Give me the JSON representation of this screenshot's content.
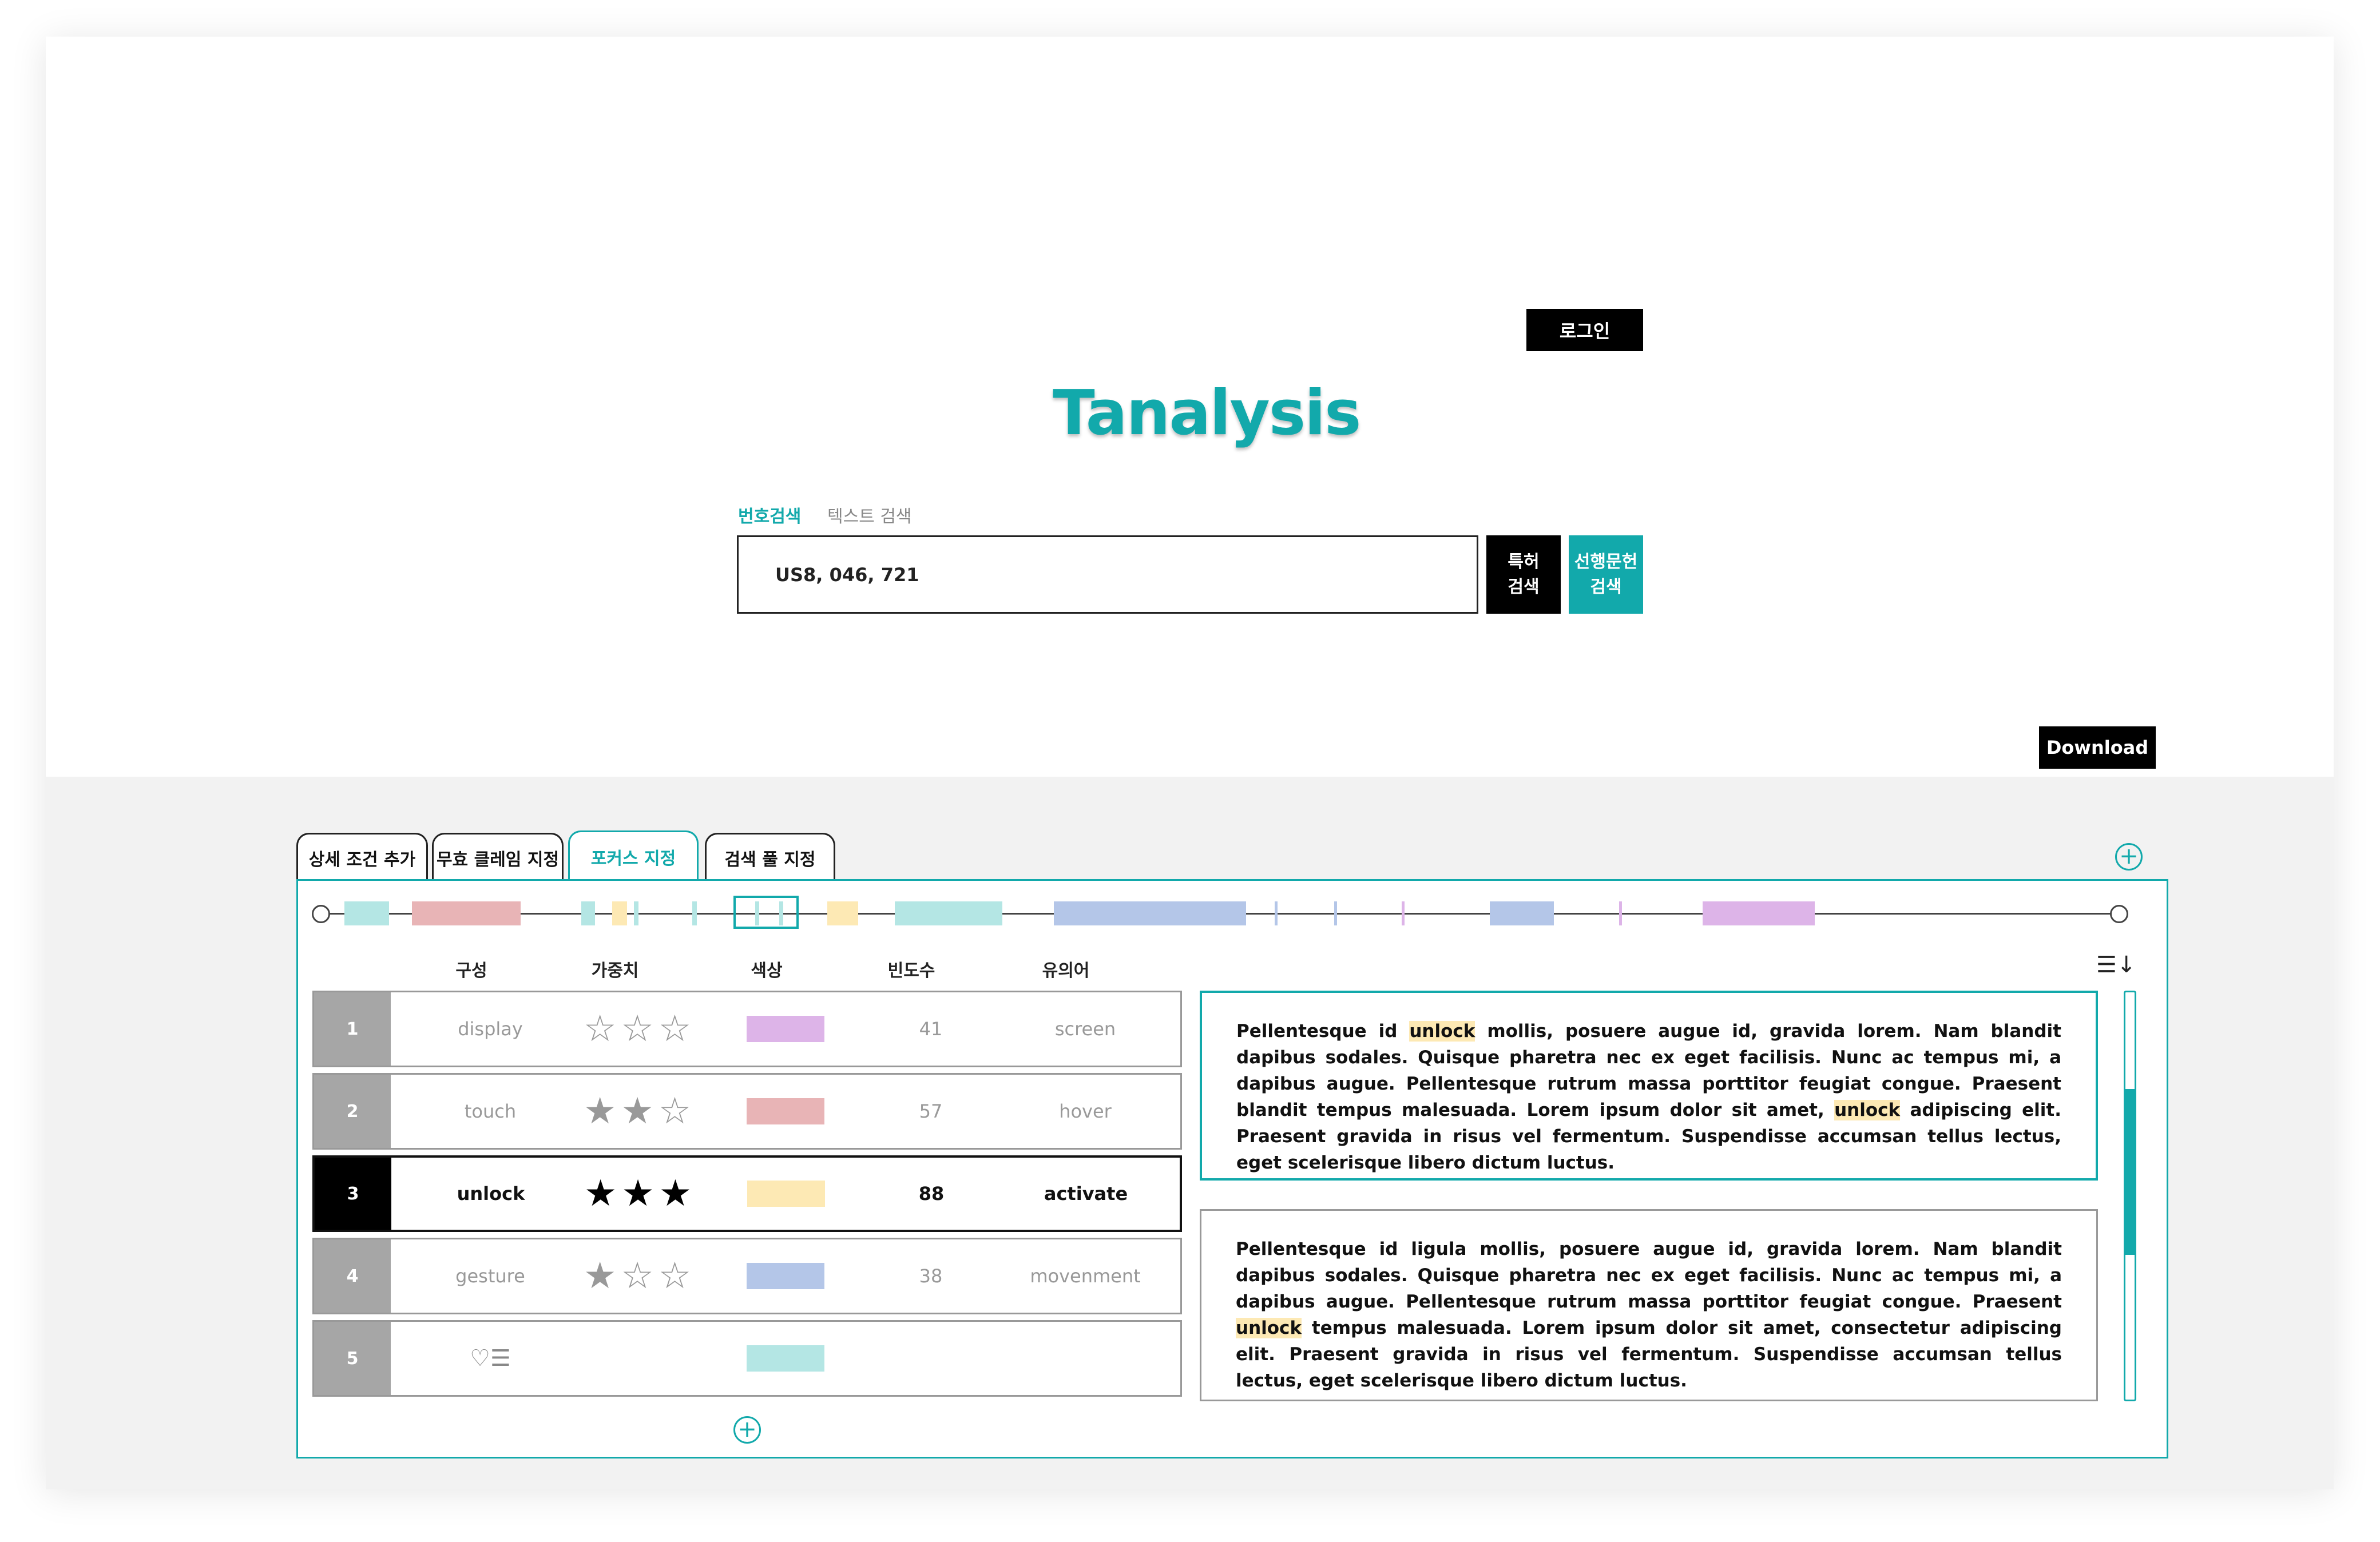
{
  "header": {
    "login_label": "로그인",
    "logo": "Tanalysis",
    "search_modes": [
      "번호검색",
      "텍스트 검색"
    ],
    "search_value": "US8, 046, 721",
    "patent_search_label": "특허\n검색",
    "prior_art_search_label": "선행문헌\n검색",
    "download_label": "Download"
  },
  "tabs": [
    {
      "label": "상세 조건 추가"
    },
    {
      "label": "무효 클레임 지정"
    },
    {
      "label": "포커스 지정"
    },
    {
      "label": "검색 풀 지정"
    }
  ],
  "table": {
    "headers": [
      "구성",
      "가중치",
      "색상",
      "빈도수",
      "유의어"
    ],
    "rows": [
      {
        "num": "1",
        "term": "display",
        "stars": 0,
        "color": "#ddb4e8",
        "freq": "41",
        "synonym": "screen"
      },
      {
        "num": "2",
        "term": "touch",
        "stars": 2,
        "color": "#e8b4b6",
        "freq": "57",
        "synonym": "hover"
      },
      {
        "num": "3",
        "term": "unlock",
        "stars": 3,
        "color": "#fde9b4",
        "freq": "88",
        "synonym": "activate"
      },
      {
        "num": "4",
        "term": "gesture",
        "stars": 1,
        "color": "#b4c6e8",
        "freq": "38",
        "synonym": "movenment"
      },
      {
        "num": "5",
        "term": "",
        "stars": null,
        "color": "#b4e6e4",
        "freq": "",
        "synonym": ""
      }
    ]
  },
  "texts": [
    {
      "parts": [
        {
          "t": "Pellentesque id "
        },
        {
          "t": "unlock",
          "hl": true
        },
        {
          "t": " mollis, posuere augue id, gravida lorem. Nam blandit dapibus sodales. Quisque pharetra nec ex eget facilisis. Nunc ac tempus mi, a dapibus augue. Pellentesque rutrum massa porttitor feugiat congue. Praesent blandit tempus malesuada. Lorem ipsum dolor sit amet, "
        },
        {
          "t": "unlock",
          "hl": true
        },
        {
          "t": " adipiscing elit. Praesent gravida in risus vel fermentum. Suspendisse accumsan tellus lectus, eget scelerisque libero dictum luctus."
        }
      ]
    },
    {
      "parts": [
        {
          "t": "Pellentesque id ligula mollis, posuere augue id, gravida lorem. Nam blandit dapibus sodales. Quisque pharetra nec ex eget facilisis. Nunc ac tempus mi, a dapibus augue. Pellentesque rutrum massa porttitor feugiat congue. Praesent "
        },
        {
          "t": "unlock",
          "hl": true
        },
        {
          "t": " tempus malesuada. Lorem ipsum dolor sit amet, consectetur adipiscing elit. Praesent gravida in risus vel fermentum. Suspendisse accumsan tellus lectus, eget scelerisque libero dictum luctus."
        }
      ]
    }
  ],
  "colors": {
    "accent": "#12a9ab",
    "teal_light": "#b4e6e4",
    "red_light": "#e8b4b6",
    "yellow_light": "#fde9b4",
    "blue_light": "#b4c6e8",
    "purple_light": "#ddb4e8"
  },
  "icons": {
    "add": "plus-circle-icon",
    "sort": "sort-icon",
    "sort_glyph": "☰↓",
    "row5_icon": "heart-list-icon",
    "row5_glyph": "♡☰",
    "star_filled": "★",
    "star_empty": "☆"
  }
}
